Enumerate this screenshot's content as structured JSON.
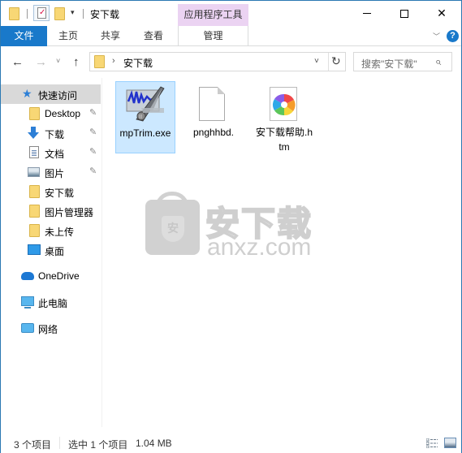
{
  "window": {
    "title": "安下载",
    "context_tab_header": "应用程序工具",
    "controls": {
      "minimize": "minimize",
      "maximize": "maximize",
      "close": "✕"
    }
  },
  "quick_access_toolbar": {
    "icons": [
      "folder-icon",
      "properties-icon",
      "new-folder-icon",
      "customize-dropdown-icon"
    ],
    "dropdown_glyph": "▾"
  },
  "ribbon": {
    "tabs": [
      {
        "label": "文件",
        "active": true
      },
      {
        "label": "主页"
      },
      {
        "label": "共享"
      },
      {
        "label": "查看"
      },
      {
        "label": "管理",
        "context": true
      }
    ],
    "expand_glyph": "﹀",
    "help_glyph": "?"
  },
  "navigation": {
    "back_glyph": "←",
    "forward_glyph": "→",
    "recent_glyph": "˅",
    "up_glyph": "↑",
    "breadcrumb_separator": "›",
    "breadcrumb": [
      "安下载"
    ],
    "address_dropdown_glyph": "˅",
    "refresh_glyph": "↻",
    "search_placeholder": "搜索\"安下载\"",
    "search_glyph": "⌕"
  },
  "sidebar": {
    "items": [
      {
        "label": "快速访问",
        "icon": "star-icon",
        "selected": true
      },
      {
        "label": "Desktop",
        "icon": "folder-icon",
        "pinned": true
      },
      {
        "label": "下载",
        "icon": "download-arrow-icon",
        "pinned": true
      },
      {
        "label": "文档",
        "icon": "document-icon",
        "pinned": true
      },
      {
        "label": "图片",
        "icon": "pictures-icon",
        "pinned": true
      },
      {
        "label": "安下载",
        "icon": "folder-icon"
      },
      {
        "label": "图片管理器",
        "icon": "folder-icon"
      },
      {
        "label": "未上传",
        "icon": "folder-icon"
      },
      {
        "label": "桌面",
        "icon": "desktop-icon"
      },
      {
        "label": "OneDrive",
        "icon": "onedrive-cloud-icon"
      },
      {
        "label": "此电脑",
        "icon": "this-pc-icon"
      },
      {
        "label": "网络",
        "icon": "network-icon"
      }
    ],
    "pin_glyph": "📌"
  },
  "files": [
    {
      "name": "mpTrim.exe",
      "icon": "mptrim-app-icon",
      "selected": true
    },
    {
      "name": "pnghhbd.",
      "icon": "blank-file-icon",
      "selected": false
    },
    {
      "name": "安下载帮助.htm",
      "icon": "htm-file-icon",
      "selected": false
    }
  ],
  "watermark": {
    "cn": "安下载",
    "en": "anxz.com",
    "badge": "安"
  },
  "statusbar": {
    "item_count": "3 个项目",
    "selected_count": "选中 1 个项目",
    "selected_size": "1.04 MB",
    "view_buttons": [
      "details-view-icon",
      "large-icons-view-icon"
    ]
  },
  "colors": {
    "accent": "#1979ca",
    "context_tab": "#ebd3f2",
    "selection_bg": "#cce8ff",
    "selection_border": "#99d1ff",
    "sidebar_selected": "#d9d9d9",
    "window_border": "#2b79b3"
  }
}
